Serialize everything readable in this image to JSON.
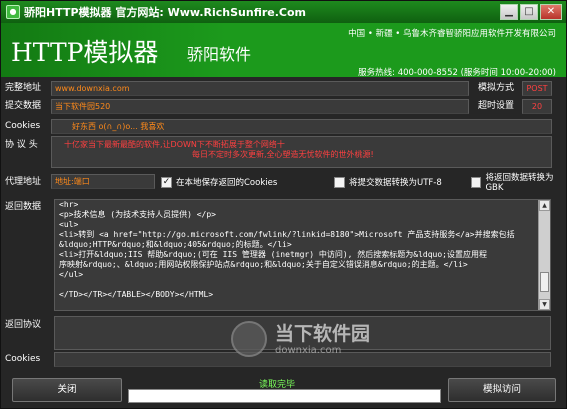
{
  "window": {
    "title": "骄阳HTTP模拟器 官方网站: Www.RichSunfire.Com",
    "app_icon": "app-icon"
  },
  "banner": {
    "title": "HTTP模拟器",
    "subtitle": "骄阳软件",
    "right_top": "中国 • 新疆 • 乌鲁木齐睿智骄阳应用软件开发有限公司",
    "right_bottom": "服务热线: 400-000-8552 (服务时间 10:00-20:00)"
  },
  "form": {
    "url_label": "完整地址",
    "url_value": "www.downxia.com",
    "method_label": "模拟方式",
    "method_value": "POST",
    "post_label": "提交数据",
    "post_value": "当下软件园520",
    "timeout_label": "超时设置",
    "timeout_value": "20",
    "cookies_label": "Cookies",
    "cookies_value": "好东西 o(∩_∩)o... 我喜欢",
    "header_label": "协 议 头",
    "header_line1": "十亿家当下最新最酷的软件,让DOWN下不断拓展于整个网络十",
    "header_line2": "每日不定时多次更新,全心塑造无忧软件的世外桃源!",
    "proxy_label": "代理地址",
    "proxy_value": "地址:端口",
    "chk_save_cookies": "在本地保存返回的Cookies",
    "chk_utf8": "将提交数据转换为UTF-8",
    "chk_gbk": "将返回数据转换为GBK",
    "response_label": "返回数据",
    "response_lines": [
      "<hr>",
      "<p>技术信息 (为技术支持人员提供) </p>",
      "<ul>",
      "<li>转到 <a href=\"http://go.microsoft.com/fwlink/?linkid=8180\">Microsoft 产品支持服务</a>并搜索包括",
      "&ldquo;HTTP&rdquo;和&ldquo;405&rdquo;的标题。</li>",
      "<li>打开&ldquo;IIS 帮助&rdquo;(可在 IIS 管理器 (inetmgr) 中访问), 然后搜索标题为&ldquo;设置应用程",
      "序映射&rdquo;、&ldquo;用网站权限保护站点&rdquo;和&ldquo;关于自定义错误消息&rdquo;的主题。</li>",
      "</ul>",
      "",
      "</TD></TR></TABLE></BODY></HTML>"
    ],
    "resp_protocol_label": "返回协议",
    "resp_cookies_label": "Cookies"
  },
  "footer": {
    "close_label": "关闭",
    "status_text": "读取完毕",
    "progress": 0,
    "simulate_label": "模拟访问"
  },
  "watermark": {
    "line1": "当下软件园",
    "line2": "downxia.com"
  }
}
